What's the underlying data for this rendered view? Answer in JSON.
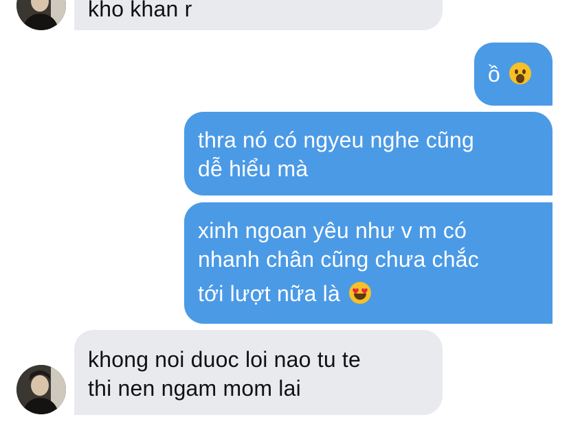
{
  "messages": [
    {
      "from": "other",
      "text": "kho khan r"
    },
    {
      "from": "me",
      "text": "ồ",
      "emoji": "hushed-face"
    },
    {
      "from": "me",
      "lines": [
        "thra nó có ngyeu nghe cũng",
        "dễ hiểu mà"
      ]
    },
    {
      "from": "me",
      "lines": [
        "xinh ngoan yêu như v m có",
        "nhanh chân cũng chưa chắc",
        "tới lượt nữa là"
      ],
      "emoji": "heart-eyes-face"
    },
    {
      "from": "other",
      "lines": [
        "khong noi duoc loi nao tu te",
        "thi nen ngam mom lai"
      ]
    }
  ],
  "colors": {
    "outgoing": "#4b9ae6",
    "incoming": "#e8eaee",
    "background": "#ffffff"
  }
}
